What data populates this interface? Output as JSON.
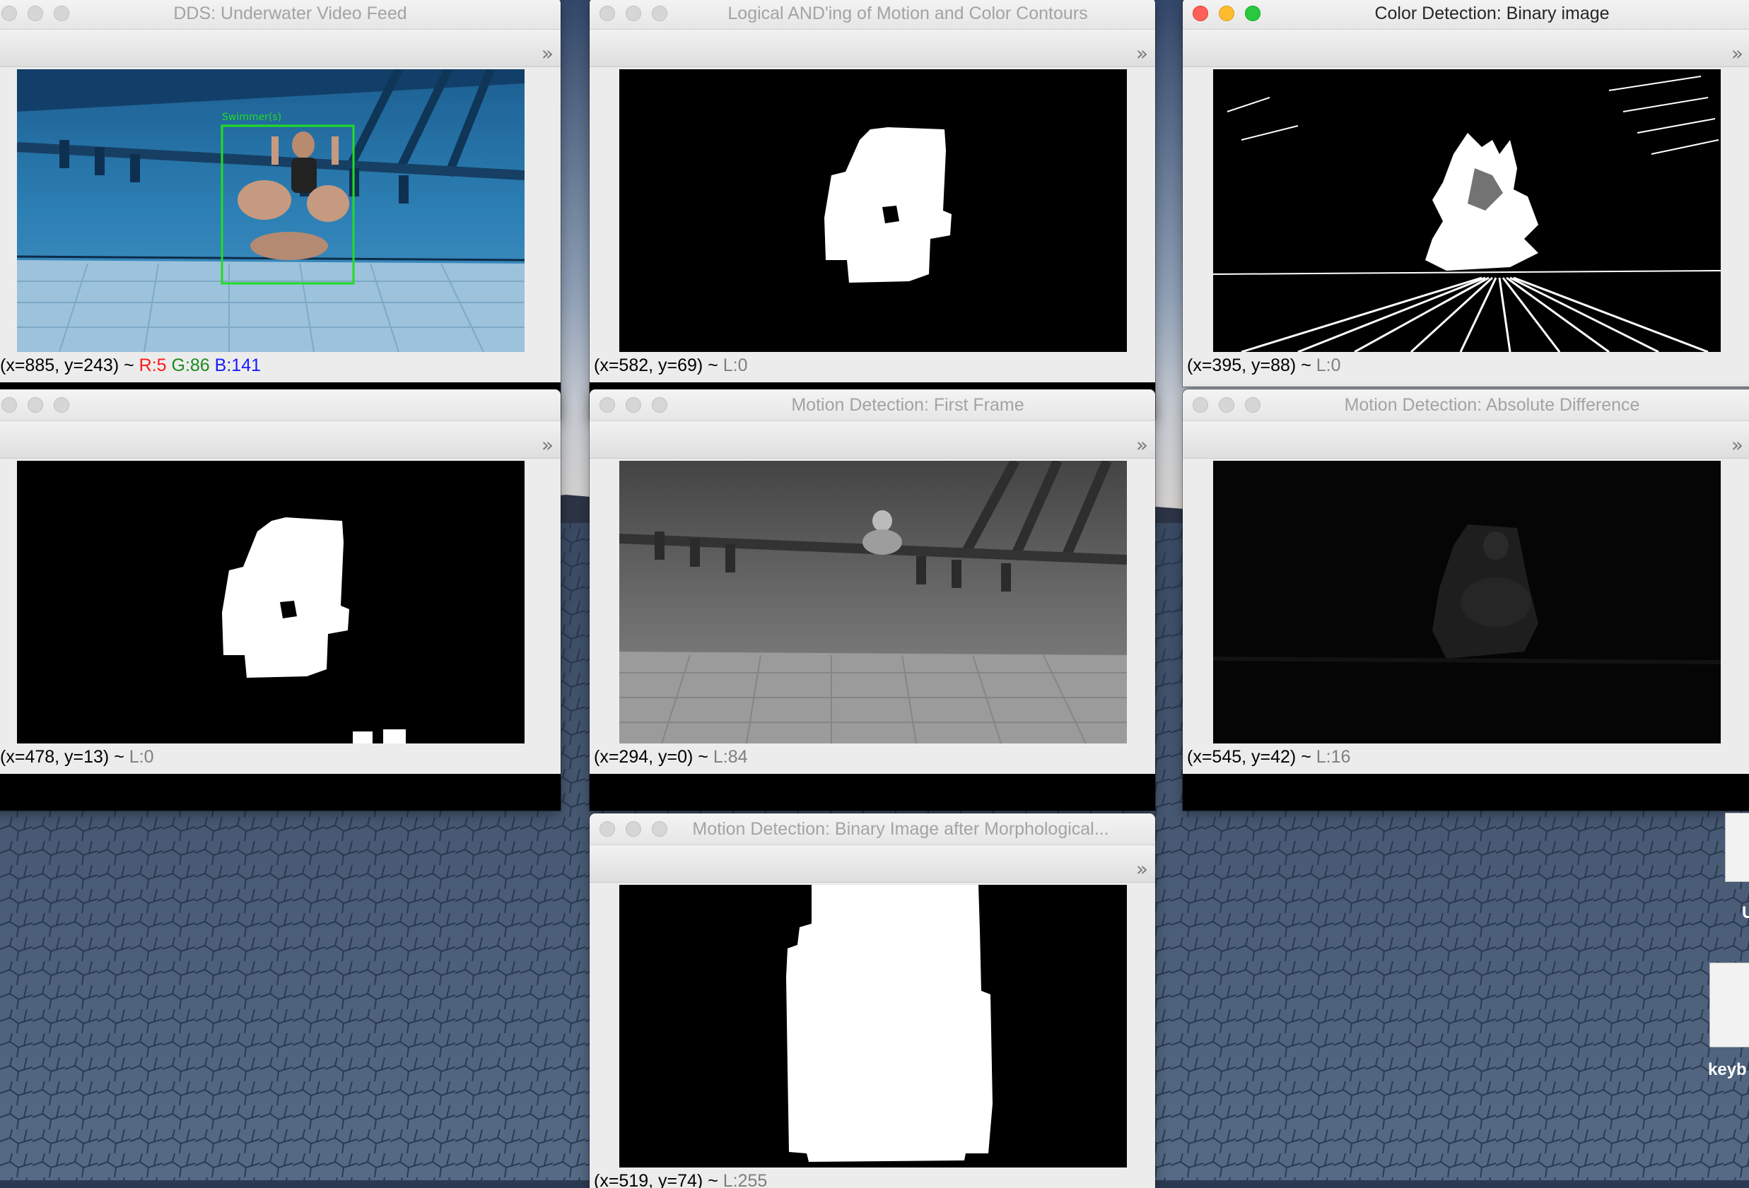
{
  "windows": {
    "feed": {
      "title": "DDS: Underwater Video Feed",
      "overlay_label": "Swimmer(s)",
      "status": {
        "coords": "(x=885, y=243) ~ ",
        "r": "R:5",
        "g": "G:86",
        "b": "B:141"
      }
    },
    "and": {
      "title": "Logical AND'ing of Motion and Color Contours",
      "status": {
        "coords": "(x=582, y=69) ~ ",
        "lum": "L:0"
      }
    },
    "color": {
      "title": "Color Detection: Binary image",
      "status": {
        "coords": "(x=395, y=88) ~ ",
        "lum": "L:0"
      }
    },
    "contours": {
      "status": {
        "coords": "(x=478, y=13) ~ ",
        "lum": "L:0"
      }
    },
    "first": {
      "title": "Motion Detection: First Frame",
      "status": {
        "coords": "(x=294, y=0) ~ ",
        "lum": "L:84"
      }
    },
    "diff": {
      "title": "Motion Detection: Absolute Difference",
      "status": {
        "coords": "(x=545, y=42) ~ ",
        "lum": "L:16"
      }
    },
    "morph": {
      "title": "Motion Detection: Binary Image after Morphological...",
      "status": {
        "coords": "(x=519, y=74) ~ ",
        "lum": "L:255"
      }
    }
  },
  "desktop": {
    "file_labels": [
      "U",
      "keyb"
    ]
  },
  "icons": {
    "more": "chevron-double-right-icon"
  },
  "colors": {
    "box": "#22dd22",
    "close": "#fe5f57",
    "minimize": "#febc2e",
    "maximize": "#28c840"
  }
}
